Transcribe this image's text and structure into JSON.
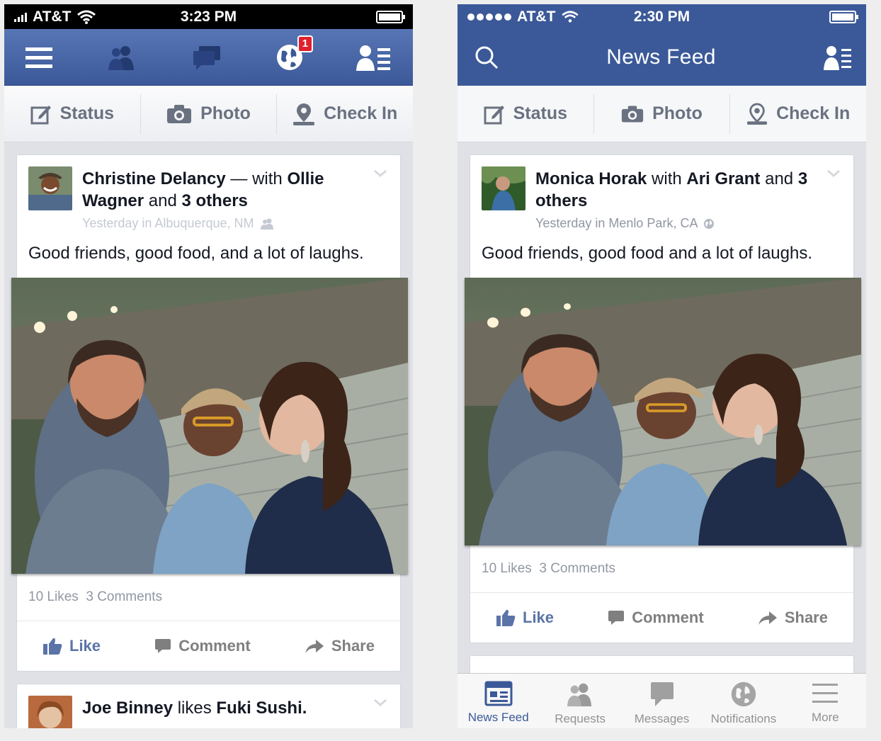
{
  "left_phone": {
    "status": {
      "carrier": "AT&T",
      "time": "3:23 PM"
    },
    "nav": {
      "notification_count": "1"
    },
    "actions": {
      "status": "Status",
      "photo": "Photo",
      "check_in": "Check In"
    },
    "post1": {
      "author": "Christine Delancy",
      "dash": " — ",
      "with": "with",
      "tagged": "Ollie Wagner",
      "and": "and",
      "others": "3 others",
      "meta": "Yesterday in Albuquerque, NM",
      "text": "Good friends, good food, and a lot of laughs.",
      "likes": "10 Likes",
      "comments": "3 Comments",
      "like": "Like",
      "comment": "Comment",
      "share": "Share"
    },
    "post2": {
      "author": "Joe Binney",
      "likes_word": "likes",
      "page": "Fuki Sushi."
    }
  },
  "right_phone": {
    "status": {
      "carrier": "AT&T",
      "time": "2:30 PM"
    },
    "nav": {
      "title": "News Feed"
    },
    "actions": {
      "status": "Status",
      "photo": "Photo",
      "check_in": "Check In"
    },
    "post1": {
      "author": "Monica Horak",
      "with": "with",
      "tagged": "Ari Grant",
      "and": "and",
      "others": "3 others",
      "meta": "Yesterday in Menlo Park, CA",
      "text": "Good friends, good food and a lot of laughs.",
      "likes": "10 Likes",
      "comments": "3 Comments",
      "like": "Like",
      "comment": "Comment",
      "share": "Share"
    },
    "tabbar": [
      {
        "label": "News Feed",
        "icon": "news-feed-icon"
      },
      {
        "label": "Requests",
        "icon": "requests-icon"
      },
      {
        "label": "Messages",
        "icon": "messages-icon"
      },
      {
        "label": "Notifications",
        "icon": "notifications-icon"
      },
      {
        "label": "More",
        "icon": "more-icon"
      }
    ]
  },
  "colors": {
    "brand_blue": "#3b5998",
    "like_blue": "#5b74a8",
    "badge_red": "#e0212e",
    "muted_text": "#9197a3"
  }
}
